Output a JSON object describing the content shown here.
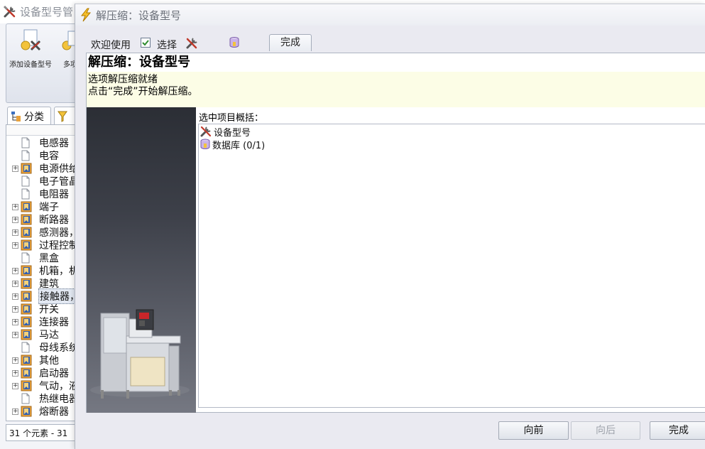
{
  "main_window": {
    "title": "设备型号管",
    "ribbon": {
      "add_device_type_label": "添加设备型号",
      "multi_label": "多项"
    },
    "tabs": {
      "category_label": "分类"
    },
    "tree": [
      {
        "label": "电感器",
        "expandable": false,
        "icon": "page-icon"
      },
      {
        "label": "电容",
        "expandable": false,
        "icon": "page-icon"
      },
      {
        "label": "电源供给",
        "expandable": true,
        "icon": "folder-book-icon"
      },
      {
        "label": "电子管晶",
        "expandable": false,
        "icon": "page-icon"
      },
      {
        "label": "电阻器",
        "expandable": false,
        "icon": "page-icon"
      },
      {
        "label": "端子",
        "expandable": true,
        "icon": "folder-book-icon"
      },
      {
        "label": "断路器",
        "expandable": true,
        "icon": "folder-book-icon"
      },
      {
        "label": "感测器，",
        "expandable": true,
        "icon": "folder-book-icon"
      },
      {
        "label": "过程控制",
        "expandable": true,
        "icon": "folder-book-icon"
      },
      {
        "label": "黑盒",
        "expandable": false,
        "icon": "page-icon"
      },
      {
        "label": "机箱，机",
        "expandable": true,
        "icon": "folder-book-icon"
      },
      {
        "label": "建筑",
        "expandable": true,
        "icon": "folder-book-icon"
      },
      {
        "label": "接触器，",
        "expandable": true,
        "icon": "folder-book-icon",
        "selected": true
      },
      {
        "label": "开关",
        "expandable": true,
        "icon": "folder-book-icon"
      },
      {
        "label": "连接器",
        "expandable": true,
        "icon": "folder-book-icon"
      },
      {
        "label": "马达",
        "expandable": true,
        "icon": "folder-book-icon"
      },
      {
        "label": "母线系统",
        "expandable": false,
        "icon": "page-icon"
      },
      {
        "label": "其他",
        "expandable": true,
        "icon": "folder-book-icon"
      },
      {
        "label": "启动器",
        "expandable": true,
        "icon": "folder-book-icon"
      },
      {
        "label": "气动，液",
        "expandable": true,
        "icon": "folder-book-icon"
      },
      {
        "label": "热继电器",
        "expandable": false,
        "icon": "page-icon"
      },
      {
        "label": "熔断器",
        "expandable": true,
        "icon": "folder-book-icon"
      }
    ],
    "status": "31 个元素 - 31"
  },
  "dialog": {
    "title": "解压缩：设备型号",
    "toolbar": {
      "welcome": "欢迎使用",
      "select": "选择",
      "select_checked": true,
      "finish_tab": "完成"
    },
    "heading": "解压缩：设备型号",
    "messages": [
      "选项解压缩就绪",
      "点击“完成”开始解压缩。"
    ],
    "summary_label": "选中项目概括：",
    "summary_items": [
      {
        "label": "设备型号",
        "icon": "tools-icon"
      },
      {
        "label": "数据库 (0/1)",
        "icon": "database-icon"
      }
    ],
    "buttons": {
      "back": "向前",
      "next": "向后",
      "finish": "完成"
    }
  },
  "colors": {
    "dialog_bg": "#eaeaf1",
    "message_band": "#fcfde6",
    "side_image_top": "#2b2e35",
    "folder_icon": "#e9a23b",
    "disabled_text": "#9ea3ab"
  }
}
